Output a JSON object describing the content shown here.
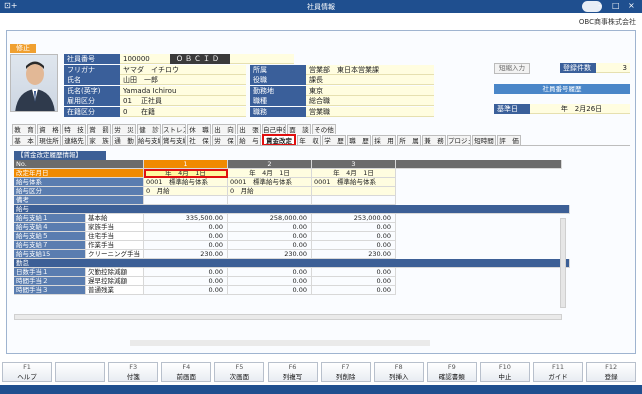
{
  "window": {
    "title": "社員情報",
    "company": "OBC商事株式会社"
  },
  "edit_badge": "修正",
  "employee": {
    "fields": [
      {
        "label": "社員番号",
        "value": "100000"
      },
      {
        "label": "フリガナ",
        "value": "ヤマダ　イチロウ"
      },
      {
        "label": "氏名",
        "value": "山田　一郎"
      },
      {
        "label": "氏名(英字)",
        "value": "Yamada Ichirou"
      },
      {
        "label": "雇用区分",
        "code": "01",
        "value": "正社員"
      },
      {
        "label": "在籍区分",
        "code": "0",
        "value": "在籍"
      }
    ],
    "obcid_label": "ＯＢＣＩＤ",
    "org_fields": [
      {
        "label": "所属",
        "value": "営業部　東日本営業課"
      },
      {
        "label": "役職",
        "value": "課長"
      },
      {
        "label": "勤務地",
        "value": "東京"
      },
      {
        "label": "職種",
        "value": "総合職"
      },
      {
        "label": "職務",
        "value": "営業職"
      }
    ]
  },
  "right_panel": {
    "short_input": "短縮入力",
    "reg_count_label": "登録件数",
    "reg_count": "3",
    "history_title": "社員番号履歴",
    "base_date_label": "基準日",
    "base_date": "年　2月26日"
  },
  "tabs_row1": [
    "教　育",
    "資　格",
    "特　技",
    "賞　罰",
    "労　災",
    "健　診",
    "ストレス",
    "休　職",
    "出　向",
    "出　張",
    "自己申告",
    "面　談",
    "その他"
  ],
  "tabs_row2": [
    "基　本",
    "現住所",
    "連絡先",
    "家　族",
    "通　勤",
    "給与支給",
    "賞与支給",
    "社　保",
    "労　保",
    "給　与",
    "賃金改定",
    "年　収",
    "学　歴",
    "職　歴",
    "採　用",
    "所　属",
    "兼　務",
    "プロジェ",
    "短時間",
    "評　価"
  ],
  "active_tab": "賃金改定",
  "grid": {
    "section_title": "【賃金改定履歴情報】",
    "no_label": "No.",
    "columns": [
      "1",
      "2",
      "3"
    ],
    "date_label": "改定年月日",
    "dates": [
      "年　4月　1日",
      "年　4月　1日",
      "年　4月　1日"
    ],
    "system_label": "給与体系",
    "systems": [
      {
        "code": "0001",
        "name": "標準給与体系"
      },
      {
        "code": "0001",
        "name": "標準給与体系"
      },
      {
        "code": "0001",
        "name": "標準給与体系"
      }
    ],
    "pay_type_label": "給与区分",
    "pay_types": [
      {
        "code": "0",
        "name": "月給"
      },
      {
        "code": "0",
        "name": "月給"
      },
      {
        "code": "",
        "name": ""
      }
    ],
    "remark_label": "備考",
    "salary_section": "給与",
    "salary_rows": [
      {
        "item": "給与支給１",
        "name": "基本給",
        "values": [
          "335,500.00",
          "258,000.00",
          "253,000.00"
        ]
      },
      {
        "item": "給与支給４",
        "name": "家族手当",
        "values": [
          "0.00",
          "0.00",
          "0.00"
        ]
      },
      {
        "item": "給与支給５",
        "name": "住宅手当",
        "values": [
          "0.00",
          "0.00",
          "0.00"
        ]
      },
      {
        "item": "給与支給７",
        "name": "作業手当",
        "values": [
          "0.00",
          "0.00",
          "0.00"
        ]
      },
      {
        "item": "給与支給15",
        "name": "クリーニング手当",
        "values": [
          "230.00",
          "230.00",
          "230.00"
        ]
      }
    ],
    "attendance_section": "勤怠",
    "attendance_rows": [
      {
        "item": "日数手当１",
        "name": "欠勤控除減額",
        "values": [
          "0.00",
          "0.00",
          "0.00"
        ]
      },
      {
        "item": "時間手当２",
        "name": "遅早控除減額",
        "values": [
          "0.00",
          "0.00",
          "0.00"
        ]
      },
      {
        "item": "時間手当３",
        "name": "普通残業",
        "values": [
          "0.00",
          "0.00",
          "0.00"
        ]
      }
    ]
  },
  "fkeys": [
    {
      "key": "F1",
      "label": "ヘルプ"
    },
    {
      "key": "",
      "label": ""
    },
    {
      "key": "F3",
      "label": "付箋"
    },
    {
      "key": "F4",
      "label": "前画面"
    },
    {
      "key": "F5",
      "label": "次画面"
    },
    {
      "key": "F6",
      "label": "列複写"
    },
    {
      "key": "F7",
      "label": "列削除"
    },
    {
      "key": "F8",
      "label": "列挿入"
    },
    {
      "key": "F9",
      "label": "確認書類"
    },
    {
      "key": "F10",
      "label": "中止"
    },
    {
      "key": "F11",
      "label": "ガイド"
    },
    {
      "key": "F12",
      "label": "登録"
    }
  ],
  "colors": {
    "accent": "#1f4f8f",
    "label_bg": "#3a5f9a",
    "highlight": "#f0a030",
    "active_border": "#e01010"
  }
}
